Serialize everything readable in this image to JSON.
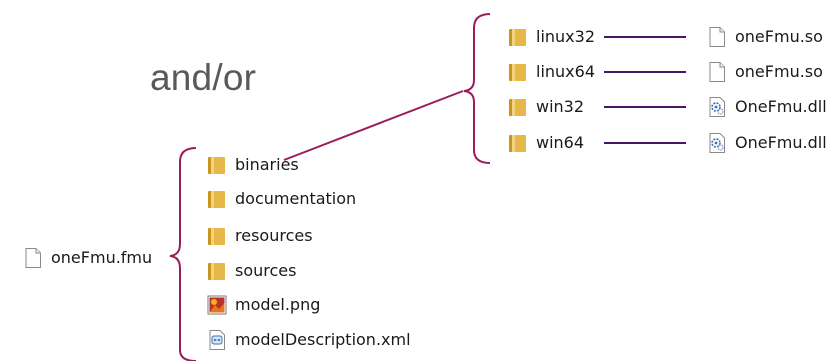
{
  "colors": {
    "bracket": "#9c1b5e",
    "connector": "#4a1568",
    "and_or_text": "#595959",
    "folder": "#e6b84a",
    "folder_dark": "#c9951f"
  },
  "label": "and/or",
  "root": {
    "name": "oneFmu.fmu",
    "icon": "file-icon"
  },
  "fmu_contents": [
    {
      "name": "binaries",
      "icon": "folder-icon"
    },
    {
      "name": "documentation",
      "icon": "folder-icon"
    },
    {
      "name": "resources",
      "icon": "folder-icon"
    },
    {
      "name": "sources",
      "icon": "folder-icon"
    },
    {
      "name": "model.png",
      "icon": "image-file-icon"
    },
    {
      "name": "modelDescription.xml",
      "icon": "xml-file-icon"
    }
  ],
  "binaries_contents": [
    {
      "name": "linux32",
      "icon": "folder-icon"
    },
    {
      "name": "linux64",
      "icon": "folder-icon"
    },
    {
      "name": "win32",
      "icon": "folder-icon"
    },
    {
      "name": "win64",
      "icon": "folder-icon"
    }
  ],
  "binary_files": [
    {
      "name": "oneFmu.so",
      "icon": "file-icon"
    },
    {
      "name": "oneFmu.so",
      "icon": "file-icon"
    },
    {
      "name": "OneFmu.dll",
      "icon": "dll-file-icon"
    },
    {
      "name": "OneFmu.dll",
      "icon": "dll-file-icon"
    }
  ]
}
